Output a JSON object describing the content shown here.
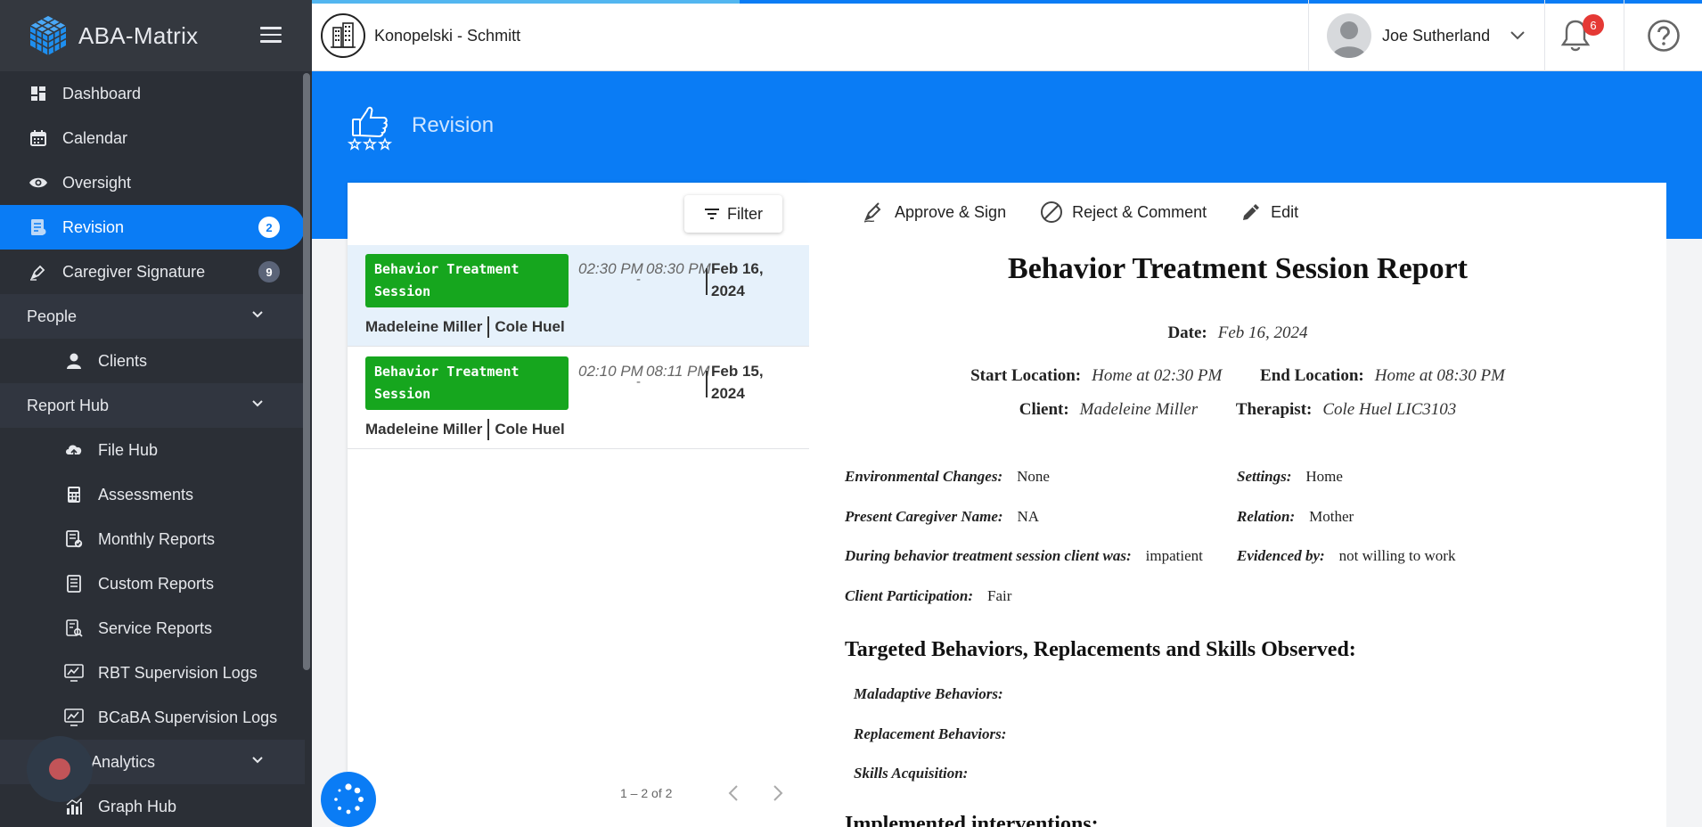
{
  "app": {
    "name": "ABA-Matrix"
  },
  "org": {
    "name": "Konopelski - Schmitt"
  },
  "user": {
    "name": "Joe Sutherland",
    "notifications": "6"
  },
  "sidebar": {
    "items": [
      {
        "label": "Dashboard",
        "icon": "dashboard-icon"
      },
      {
        "label": "Calendar",
        "icon": "calendar-icon"
      },
      {
        "label": "Oversight",
        "icon": "eye-icon"
      },
      {
        "label": "Revision",
        "icon": "revision-icon",
        "badge": "2"
      },
      {
        "label": "Caregiver Signature",
        "icon": "pen-icon",
        "badge": "9"
      }
    ],
    "people": {
      "label": "People",
      "items": [
        {
          "label": "Clients",
          "icon": "person-icon"
        }
      ]
    },
    "report_hub": {
      "label": "Report Hub",
      "items": [
        {
          "label": "File Hub",
          "icon": "cloud-icon"
        },
        {
          "label": "Assessments",
          "icon": "calculator-icon"
        },
        {
          "label": "Monthly Reports",
          "icon": "report-check-icon"
        },
        {
          "label": "Custom Reports",
          "icon": "report-icon"
        },
        {
          "label": "Service Reports",
          "icon": "report-search-icon"
        },
        {
          "label": "RBT Supervision Logs",
          "icon": "monitor-chart-icon"
        },
        {
          "label": "BCaBA Supervision Logs",
          "icon": "monitor-chart-icon"
        }
      ]
    },
    "analytics": {
      "label": "Analytics",
      "items": [
        {
          "label": "Graph Hub",
          "icon": "bar-chart-icon"
        }
      ]
    }
  },
  "page": {
    "title": "Revision"
  },
  "list": {
    "filter_label": "Filter",
    "sessions": [
      {
        "type": "Behavior Treatment Session",
        "start": "02:30 PM",
        "end": "08:30 PM",
        "date": "Feb 16, 2024",
        "client": "Madeleine Miller",
        "therapist": "Cole Huel"
      },
      {
        "type": "Behavior Treatment Session",
        "start": "02:10 PM",
        "end": "08:11 PM",
        "date": "Feb 15, 2024",
        "client": "Madeleine Miller",
        "therapist": "Cole Huel"
      }
    ],
    "pager": "1 – 2 of 2"
  },
  "report": {
    "actions": {
      "approve": "Approve & Sign",
      "reject": "Reject & Comment",
      "edit": "Edit"
    },
    "title": "Behavior Treatment Session Report",
    "date_label": "Date:",
    "date": "Feb 16, 2024",
    "start_location_label": "Start Location:",
    "start_location": "Home at 02:30 PM",
    "end_location_label": "End Location:",
    "end_location": "Home at 08:30 PM",
    "client_label": "Client:",
    "client": "Madeleine Miller",
    "therapist_label": "Therapist:",
    "therapist": "Cole Huel LIC3103",
    "env_label": "Environmental Changes:",
    "env": "None",
    "settings_label": "Settings:",
    "settings": "Home",
    "caregiver_label": "Present Caregiver Name:",
    "caregiver": "NA",
    "relation_label": "Relation:",
    "relation": "Mother",
    "during_label": "During behavior treatment session client was:",
    "during": "impatient",
    "evidenced_label": "Evidenced by:",
    "evidenced": "not willing to work",
    "participation_label": "Client Participation:",
    "participation": "Fair",
    "section_targeted": "Targeted Behaviors, Replacements and Skills Observed:",
    "maladaptive_label": "Maladaptive Behaviors:",
    "replacement_label": "Replacement Behaviors:",
    "skills_label": "Skills Acquisition:",
    "section_interventions": "Implemented interventions:"
  },
  "colors": {
    "primary": "#0a7cf5",
    "sidebar": "#2b2f36",
    "session_tag": "#16a61e",
    "notification": "#e53935"
  }
}
